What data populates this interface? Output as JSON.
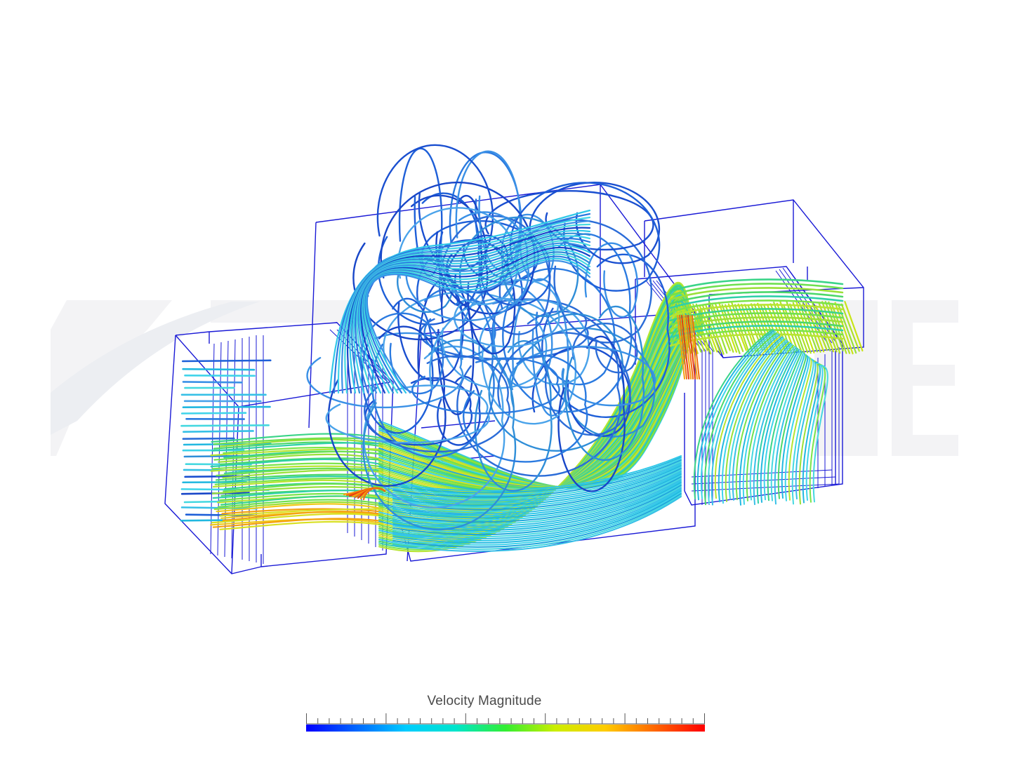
{
  "watermark": {
    "logo_name": "simscale-logo-watermark"
  },
  "scene": {
    "render_type": "streamlines",
    "outline_color": "#1a1ad6"
  },
  "legend": {
    "title": "Velocity Magnitude",
    "colormap": [
      "#0000ff",
      "#0066ff",
      "#00ccff",
      "#00e5cc",
      "#33ee33",
      "#ccee00",
      "#ffcc00",
      "#ff6600",
      "#ff0000"
    ]
  }
}
